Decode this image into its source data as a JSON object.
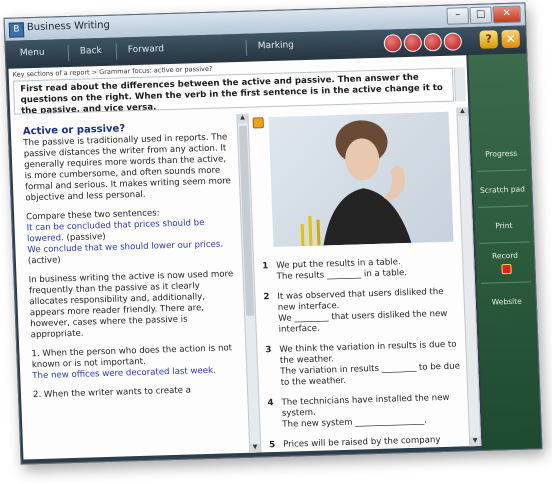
{
  "window": {
    "title": "Business Writing",
    "controls": [
      "–",
      "□",
      "✕"
    ]
  },
  "toolbar": {
    "menu": "Menu",
    "back": "Back",
    "forward": "Forward",
    "marking": "Marking",
    "help": "?",
    "close": "✕"
  },
  "breadcrumb": "Key sections of a report > Grammar focus: active or passive?",
  "instruction": "First read about the differences between the active and passive. Then answer the questions on the right. When the verb in the first sentence is in the active change it to the passive, and vice versa.",
  "reading": {
    "heading": "Active or passive?",
    "p1": "The passive is traditionally used in reports. The passive distances the writer from any action. It generally requires more words than the active, is more cumbersome, and often sounds more formal and serious. It makes writing seem more objective and less personal.",
    "p2_intro": "Compare these two sentences:",
    "example1": "It can be concluded that prices should be lowered.",
    "example1_tag": "(passive)",
    "example2": "We conclude that we should lower our prices.",
    "example2_tag": "(active)",
    "p3": "In business writing the active is now used more frequently than the passive as it clearly allocates responsibility and, additionally, appears more reader friendly. There are, however, cases where the passive is appropriate.",
    "p4": "1. When the person who does the action is not known or is not important.",
    "p4_example": "The new offices were decorated last week.",
    "p5": "2. When the writer wants to create a"
  },
  "questions": [
    {
      "n": "1",
      "a": "We put the results in a table.",
      "b": "The results ________ in a table."
    },
    {
      "n": "2",
      "a": "It was observed that users disliked the new interface.",
      "b": "We ________ that users disliked the new interface."
    },
    {
      "n": "3",
      "a": "We think the variation in results is due to the weather.",
      "b": "The variation in results ________ to be due to the weather."
    },
    {
      "n": "4",
      "a": "The technicians have installed the new system.",
      "b": "The new system ________________."
    },
    {
      "n": "5",
      "a": "Prices will be raised by the company",
      "b": ""
    }
  ],
  "sidebar": {
    "progress": "Progress",
    "scratch": "Scratch pad",
    "print": "Print",
    "record": "Record",
    "website": "Website"
  },
  "colors": {
    "toolbar": "#2d3d4a",
    "sidebar": "#2e5a3c",
    "link_blue": "#2a36b8",
    "circle_red": "#c41e1e"
  }
}
